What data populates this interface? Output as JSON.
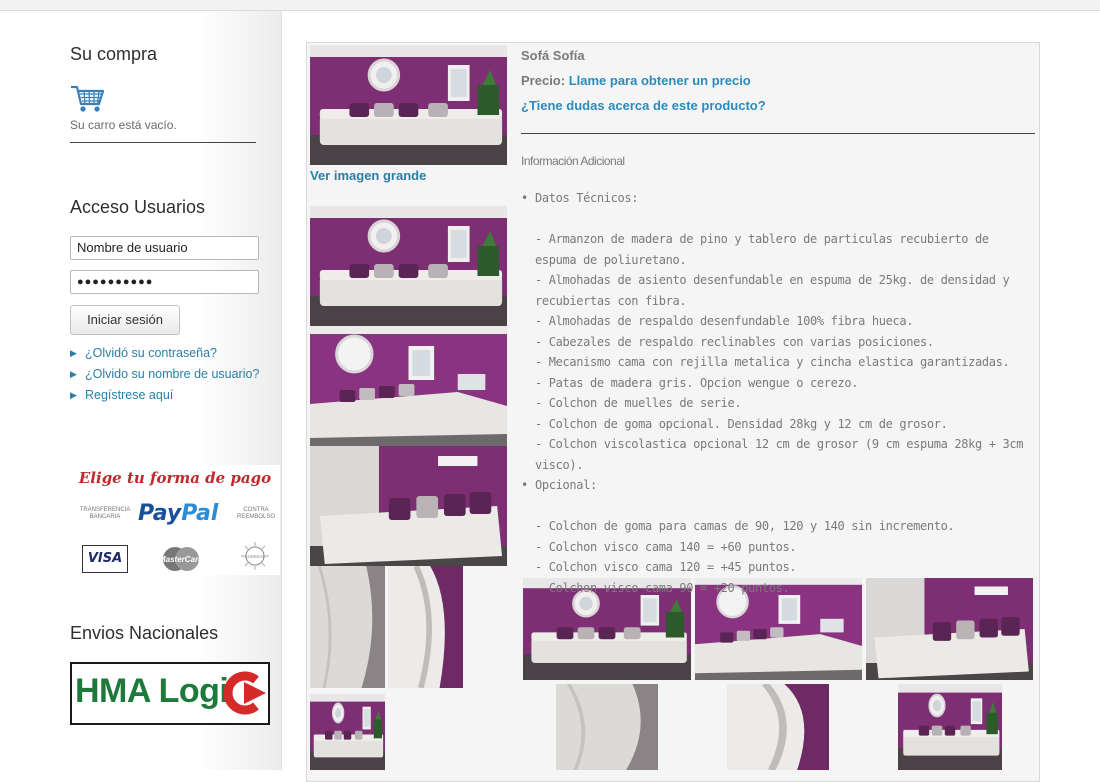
{
  "sidebar": {
    "cart": {
      "title": "Su compra",
      "empty_text": "Su carro está vacío."
    },
    "login": {
      "title": "Acceso Usuarios",
      "username_value": "Nombre de usuario",
      "password_value": "●●●●●●●●●●",
      "submit_label": "Iniciar sesión",
      "links": [
        "¿Olvidó su contraseña?",
        "¿Olvido su nombre de usuario?",
        "Regístrese aquí"
      ]
    },
    "payment": {
      "title": "Elige tu forma de pago",
      "transfer": "TRANSFERENCIA BANCARIA",
      "paypal_a": "Pay",
      "paypal_b": "Pal",
      "cod": "CONTRA REEMBOLSO",
      "visa": "VISA",
      "mastercard": "MasterCard",
      "correos": "CORREOS"
    },
    "shipping": {
      "title": "Envios Nacionales",
      "logo_text": "HMA Logi"
    }
  },
  "product": {
    "name": "Sofá Sofía",
    "price_label": "Precio:",
    "price_value": "Llame para obtener un precio",
    "question_link": "¿Tiene dudas acerca de este producto?",
    "large_image_link": "Ver imagen grande",
    "info_title": "Información Adicional",
    "specs": {
      "tech_title": "Datos Técnicos:",
      "tech_items": [
        "- Armanzon de madera de pino y tablero de particulas recubierto de espuma de poliuretano.",
        "- Almohadas de asiento desenfundable en espuma de 25kg. de densidad y recubiertas con fibra.",
        "- Almohadas de respaldo desenfundable 100% fibra hueca.",
        "- Cabezales de respaldo reclinables con varias posiciones.",
        "- Mecanismo cama con rejilla metalica y cincha elastica garantizadas.",
        "- Patas de madera gris. Opcion wengue o cerezo.",
        "- Colchon de muelles de serie.",
        "- Colchon de goma opcional. Densidad 28kg y 12 cm de grosor.",
        "- Colchon viscolastica opcional 12 cm de grosor (9 cm espuma 28kg + 3cm visco)."
      ],
      "optional_title": "Opcional:",
      "optional_items": [
        "- Colchon de goma para camas de 90, 120 y 140 sin incremento.",
        "- Colchon visco cama 140 = +60 puntos.",
        "- Colchon visco cama 120 = +45 puntos.",
        "- Colchon visco cama 90 = +20 puntos."
      ]
    }
  },
  "colors": {
    "link": "#2a7fa8",
    "wall_purple": "#7e2f73",
    "sofa_white": "#e8e6e3",
    "cushion_purple": "#5a2554",
    "hma_green": "#1d7a3a",
    "hma_red": "#d42a2a"
  }
}
